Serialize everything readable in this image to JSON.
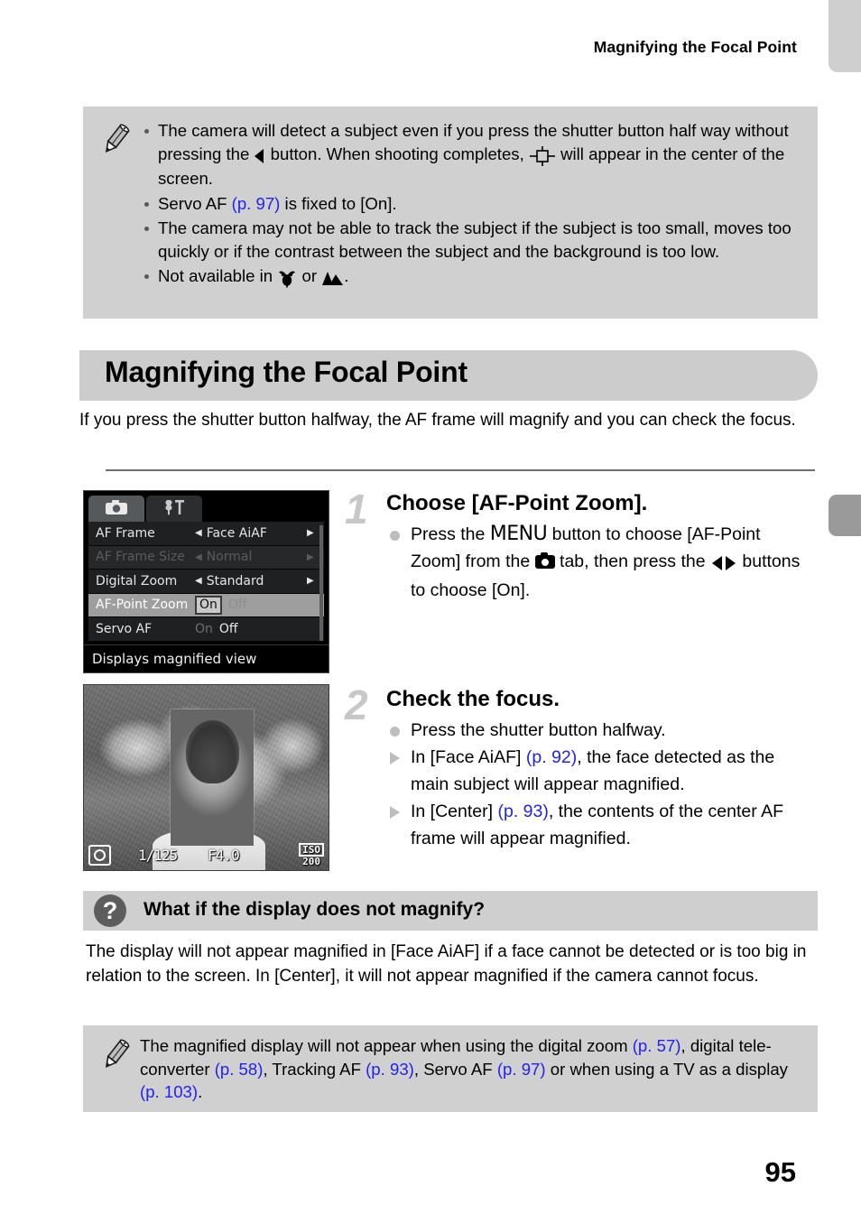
{
  "page": {
    "running_header": "Magnifying the Focal Point",
    "page_number": "95"
  },
  "top_note": {
    "icon": "pencil-memo-icon",
    "bullets": [
      {
        "parts": [
          {
            "t": "The camera will detect a subject even if you press the shutter button half way without pressing the "
          },
          {
            "icon": "left-arrow-button-icon"
          },
          {
            "t": " button. When shooting completes, "
          },
          {
            "icon": "af-frame-icon"
          },
          {
            "t": " will appear in the center of the screen."
          }
        ]
      },
      {
        "parts": [
          {
            "t": "Servo AF "
          },
          {
            "ref": "(p. 97)"
          },
          {
            "t": " is fixed to [On]."
          }
        ]
      },
      {
        "parts": [
          {
            "t": "The camera may not be able to track the subject if the subject is too small, moves too quickly or if the contrast between the subject and the background is too low."
          }
        ]
      },
      {
        "parts": [
          {
            "t": "Not available in "
          },
          {
            "icon": "macro-tulip-icon"
          },
          {
            "t": " or "
          },
          {
            "icon": "landscape-mountain-icon"
          },
          {
            "t": "."
          }
        ]
      }
    ]
  },
  "section": {
    "title": "Magnifying the Focal Point",
    "intro": "If you press the shutter button halfway, the AF frame will magnify and you can check the focus."
  },
  "lcd_menu": {
    "tabs": [
      {
        "name": "shooting-tab",
        "icon": "camera-icon",
        "selected": true
      },
      {
        "name": "settings-tab",
        "icon": "wrench-hammer-icon",
        "selected": false
      }
    ],
    "rows": [
      {
        "label": "AF Frame",
        "value": "Face AiAF",
        "type": "arrows",
        "state": "normal"
      },
      {
        "label": "AF Frame Size",
        "value": "Normal",
        "type": "arrows",
        "state": "dimmed"
      },
      {
        "label": "Digital Zoom",
        "value": "Standard",
        "type": "arrows",
        "state": "normal"
      },
      {
        "label": "AF-Point Zoom",
        "type": "onoff",
        "on": "On",
        "off": "Off",
        "selected_value": "On",
        "state": "selected"
      },
      {
        "label": "Servo AF",
        "type": "onoff",
        "on": "On",
        "off": "Off",
        "selected_value": "Off",
        "state": "normal"
      }
    ],
    "hint": "Displays magnified view"
  },
  "photo_osd": {
    "metering_icon": "evaluative-metering-icon",
    "shutter_speed": "1/125",
    "aperture": "F4.0",
    "iso_label": "ISO",
    "iso_value": "200"
  },
  "steps": [
    {
      "number": "1",
      "heading": "Choose [AF-Point Zoom].",
      "lines": [
        {
          "marker": "dot",
          "parts": [
            {
              "t": "Press the "
            },
            {
              "menuword": "MENU"
            },
            {
              "t": " button to choose [AF-Point Zoom] from the "
            },
            {
              "icon": "camera-icon"
            },
            {
              "t": " tab, then press the "
            },
            {
              "icon": "left-right-buttons-icon"
            },
            {
              "t": " buttons to choose [On]."
            }
          ]
        }
      ]
    },
    {
      "number": "2",
      "heading": "Check the focus.",
      "lines": [
        {
          "marker": "dot",
          "parts": [
            {
              "t": "Press the shutter button halfway."
            }
          ]
        },
        {
          "marker": "tri",
          "parts": [
            {
              "t": "In [Face AiAF] "
            },
            {
              "ref": "(p. 92)"
            },
            {
              "t": ", the face detected as the main subject will appear magnified."
            }
          ]
        },
        {
          "marker": "tri",
          "parts": [
            {
              "t": "In [Center] "
            },
            {
              "ref": "(p. 93)"
            },
            {
              "t": ", the contents of the center AF frame will appear magnified."
            }
          ]
        }
      ]
    }
  ],
  "qa": {
    "icon": "question-mark-icon",
    "title": "What if the display does not magnify?",
    "body": "The display will not appear magnified in [Face AiAF] if a face cannot be detected or is too big in relation to the screen. In [Center], it will not appear magnified if the camera cannot focus."
  },
  "bottom_note": {
    "icon": "pencil-memo-icon",
    "parts": [
      {
        "t": "The magnified display will not appear when using the digital zoom "
      },
      {
        "ref": "(p. 57)"
      },
      {
        "t": ", digital tele-converter "
      },
      {
        "ref": "(p. 58)"
      },
      {
        "t": ", Tracking AF "
      },
      {
        "ref": "(p. 93)"
      },
      {
        "t": ", Servo AF "
      },
      {
        "ref": "(p. 97)"
      },
      {
        "t": " or when using a TV as a display "
      },
      {
        "ref": "(p. 103)"
      },
      {
        "t": "."
      }
    ]
  },
  "colors": {
    "note_bg": "#d0d0d0",
    "banner_bg": "#cccccc",
    "page_ref": "#2222ee",
    "tab_light": "#cfcfcf",
    "tab_dark": "#9a9a9a"
  }
}
